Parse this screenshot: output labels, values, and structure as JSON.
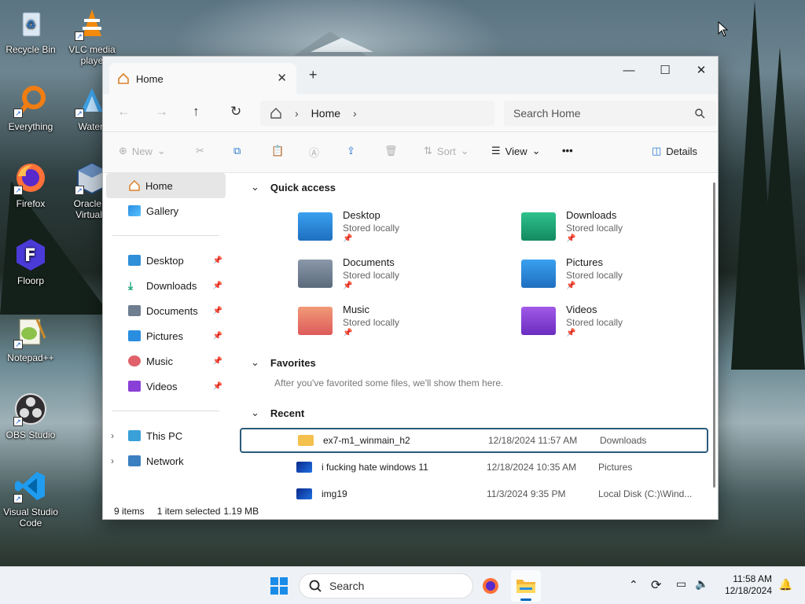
{
  "desktop": {
    "icons": [
      {
        "label": "Recycle Bin",
        "icon": "recycle-bin-icon"
      },
      {
        "label": "VLC media playe",
        "icon": "vlc-icon"
      },
      {
        "label": "Everything",
        "icon": "everything-search-icon"
      },
      {
        "label": "Waterf",
        "icon": "waterfox-icon"
      },
      {
        "label": "Firefox",
        "icon": "firefox-icon"
      },
      {
        "label": "Oracle V VirtualB",
        "icon": "virtualbox-icon"
      },
      {
        "label": "Floorp",
        "icon": "floorp-icon"
      },
      {
        "label": "Notepad++",
        "icon": "notepadpp-icon"
      },
      {
        "label": "OBS Studio",
        "icon": "obs-icon"
      },
      {
        "label": "Visual Studio Code",
        "icon": "vscode-icon"
      }
    ]
  },
  "explorer": {
    "tab_title": "Home",
    "new_tab": "+",
    "window_controls": {
      "minimize": "—",
      "maximize": "☐",
      "close": "✕"
    },
    "path": {
      "home_label": "Home",
      "separator": "›"
    },
    "search_placeholder": "Search Home",
    "toolbar": {
      "new": "New",
      "sort": "Sort",
      "view": "View",
      "more": "•••",
      "details": "Details"
    },
    "sidebar": {
      "top": [
        {
          "label": "Home",
          "icon": "home-icon",
          "selected": true
        },
        {
          "label": "Gallery",
          "icon": "gallery-icon"
        }
      ],
      "pinned": [
        {
          "label": "Desktop",
          "icon": "desktop-folder-icon",
          "color": "#2f8fd8"
        },
        {
          "label": "Downloads",
          "icon": "download-icon",
          "color": "#1aa37a"
        },
        {
          "label": "Documents",
          "icon": "document-icon",
          "color": "#6f7e90"
        },
        {
          "label": "Pictures",
          "icon": "pictures-icon",
          "color": "#2a8ee0"
        },
        {
          "label": "Music",
          "icon": "music-icon",
          "color": "#e0616a"
        },
        {
          "label": "Videos",
          "icon": "videos-icon",
          "color": "#8a3fd6"
        }
      ],
      "bottom": [
        {
          "label": "This PC",
          "icon": "pc-icon"
        },
        {
          "label": "Network",
          "icon": "network-icon"
        }
      ]
    },
    "quick_access": {
      "title": "Quick access",
      "items": [
        {
          "name": "Desktop",
          "status": "Stored locally",
          "color": "#2a8ee0"
        },
        {
          "name": "Downloads",
          "status": "Stored locally",
          "color": "#1fa57b"
        },
        {
          "name": "Documents",
          "status": "Stored locally",
          "color": "#6f7e90"
        },
        {
          "name": "Pictures",
          "status": "Stored locally",
          "color": "#2a8ee0"
        },
        {
          "name": "Music",
          "status": "Stored locally",
          "color": "#e77a5e"
        },
        {
          "name": "Videos",
          "status": "Stored locally",
          "color": "#8a3fd6"
        }
      ]
    },
    "favorites": {
      "title": "Favorites",
      "empty_text": "After you've favorited some files, we'll show them here."
    },
    "recent": {
      "title": "Recent",
      "rows": [
        {
          "name": "ex7-m1_winmain_h2",
          "date": "12/18/2024 11:57 AM",
          "location": "Downloads",
          "icon": "folder-icon",
          "selected": true
        },
        {
          "name": "i fucking hate windows 11",
          "date": "12/18/2024 10:35 AM",
          "location": "Pictures",
          "icon": "image-file-icon"
        },
        {
          "name": "img19",
          "date": "11/3/2024 9:35 PM",
          "location": "Local Disk (C:)\\Wind...",
          "icon": "image-file-icon"
        }
      ]
    },
    "status": {
      "items": "9 items",
      "selected": "1 item selected",
      "size": "1.19 MB"
    }
  },
  "taskbar": {
    "search_placeholder": "Search",
    "time": "11:58 AM",
    "date": "12/18/2024"
  },
  "colors": {
    "accent": "#0067c0",
    "selection_border": "#2b5a7a"
  }
}
